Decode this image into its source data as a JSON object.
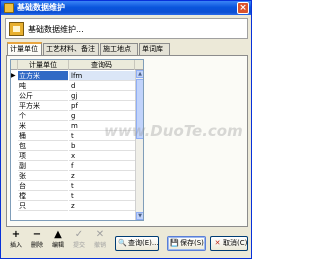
{
  "window": {
    "title": "基础数据维护",
    "close_symbol": "×"
  },
  "header": {
    "text": "基础数据维护..."
  },
  "tabs": [
    {
      "label": "计量单位",
      "active": true
    },
    {
      "label": "工艺材料、备注",
      "active": false
    },
    {
      "label": "施工地点",
      "active": false
    },
    {
      "label": "单词库",
      "active": false
    }
  ],
  "table": {
    "columns": [
      "计量单位",
      "查询码"
    ],
    "selected_marker": "▶",
    "rows": [
      {
        "unit": "立方米",
        "code": "lfm"
      },
      {
        "unit": "吨",
        "code": "d"
      },
      {
        "unit": "公斤",
        "code": "gj"
      },
      {
        "unit": "平方米",
        "code": "pf"
      },
      {
        "unit": "个",
        "code": "g"
      },
      {
        "unit": "米",
        "code": "m"
      },
      {
        "unit": "桶",
        "code": "t"
      },
      {
        "unit": "包",
        "code": "b"
      },
      {
        "unit": "项",
        "code": "x"
      },
      {
        "unit": "副",
        "code": "f"
      },
      {
        "unit": "张",
        "code": "z"
      },
      {
        "unit": "台",
        "code": "t"
      },
      {
        "unit": "樘",
        "code": "t"
      },
      {
        "unit": "只",
        "code": "z"
      }
    ]
  },
  "toolbar": [
    {
      "label": "插入",
      "icon": "+",
      "name": "insert",
      "enabled": true
    },
    {
      "label": "删除",
      "icon": "−",
      "name": "delete",
      "enabled": true
    },
    {
      "label": "编辑",
      "icon": "▲",
      "name": "edit",
      "enabled": true
    },
    {
      "label": "提交",
      "icon": "✓",
      "name": "submit",
      "enabled": false
    },
    {
      "label": "撤销",
      "icon": "✕",
      "name": "undo",
      "enabled": false
    }
  ],
  "buttons": {
    "query": {
      "label": "查询(E)...",
      "icon": "search-icon"
    },
    "save": {
      "label": "保存(S)",
      "icon": "save-icon"
    },
    "cancel": {
      "label": "取消(C)",
      "icon": "cancel-icon"
    }
  },
  "watermark": "www.DuoTe.com"
}
